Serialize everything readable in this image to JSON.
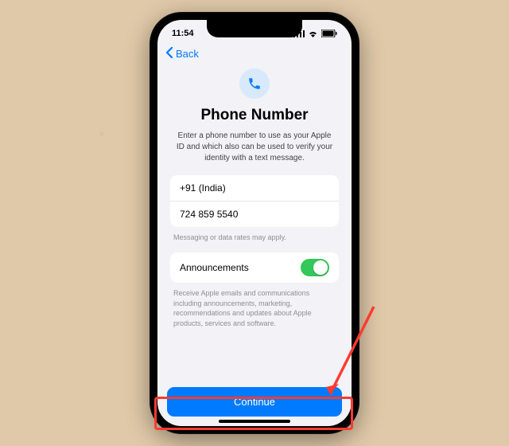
{
  "status": {
    "time": "11:54"
  },
  "nav": {
    "back_label": "Back"
  },
  "page": {
    "title": "Phone Number",
    "subtitle": "Enter a phone number to use as your Apple ID and which also can be used to verify your identity with a text message."
  },
  "fields": {
    "country": "+91 (India)",
    "phone": "724 859 5540",
    "hint": "Messaging or data rates may apply."
  },
  "announcements": {
    "label": "Announcements",
    "enabled": true,
    "description": "Receive Apple emails and communications including announcements, marketing, recommendations and updates about Apple products, services and software."
  },
  "actions": {
    "continue_label": "Continue"
  }
}
